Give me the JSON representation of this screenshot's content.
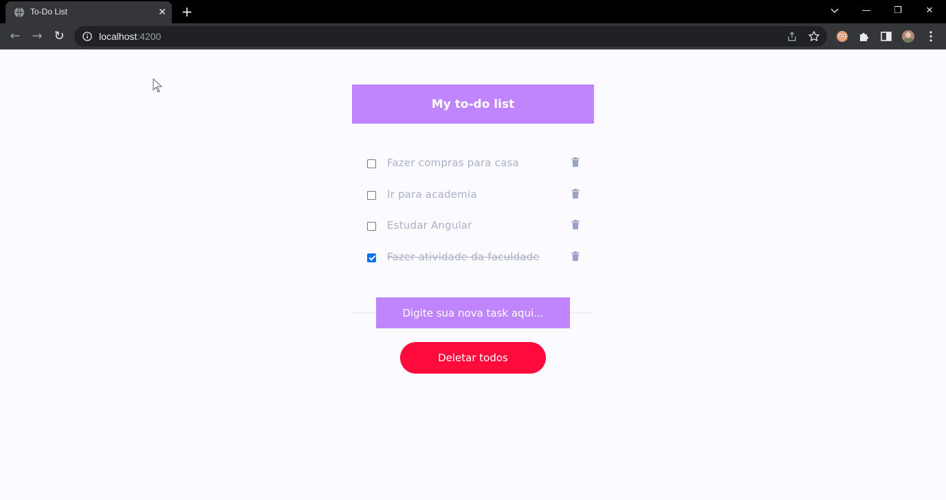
{
  "browser": {
    "tab_title": "To-Do List",
    "tab_close": "✕",
    "new_tab": "+",
    "url_host": "localhost",
    "url_port": ":4200",
    "window_buttons": {
      "minimize": "—",
      "restore": "❐",
      "close": "✕"
    },
    "nav": {
      "back": "←",
      "forward": "→",
      "reload": "↻"
    }
  },
  "app": {
    "title": "My to-do list",
    "todos": [
      {
        "text": "Fazer compras para casa",
        "done": false
      },
      {
        "text": "Ir para academia",
        "done": false
      },
      {
        "text": "Estudar Angular",
        "done": false
      },
      {
        "text": "Fazer atividade da faculdade",
        "done": true
      }
    ],
    "input_placeholder": "Digite sua nova task aqui...",
    "delete_all_label": "Deletar todos"
  },
  "colors": {
    "accent": "#c084fc",
    "danger": "#ff0a3c",
    "checkbox_checked": "#0b6ff0",
    "todo_text": "#aab0c8"
  }
}
